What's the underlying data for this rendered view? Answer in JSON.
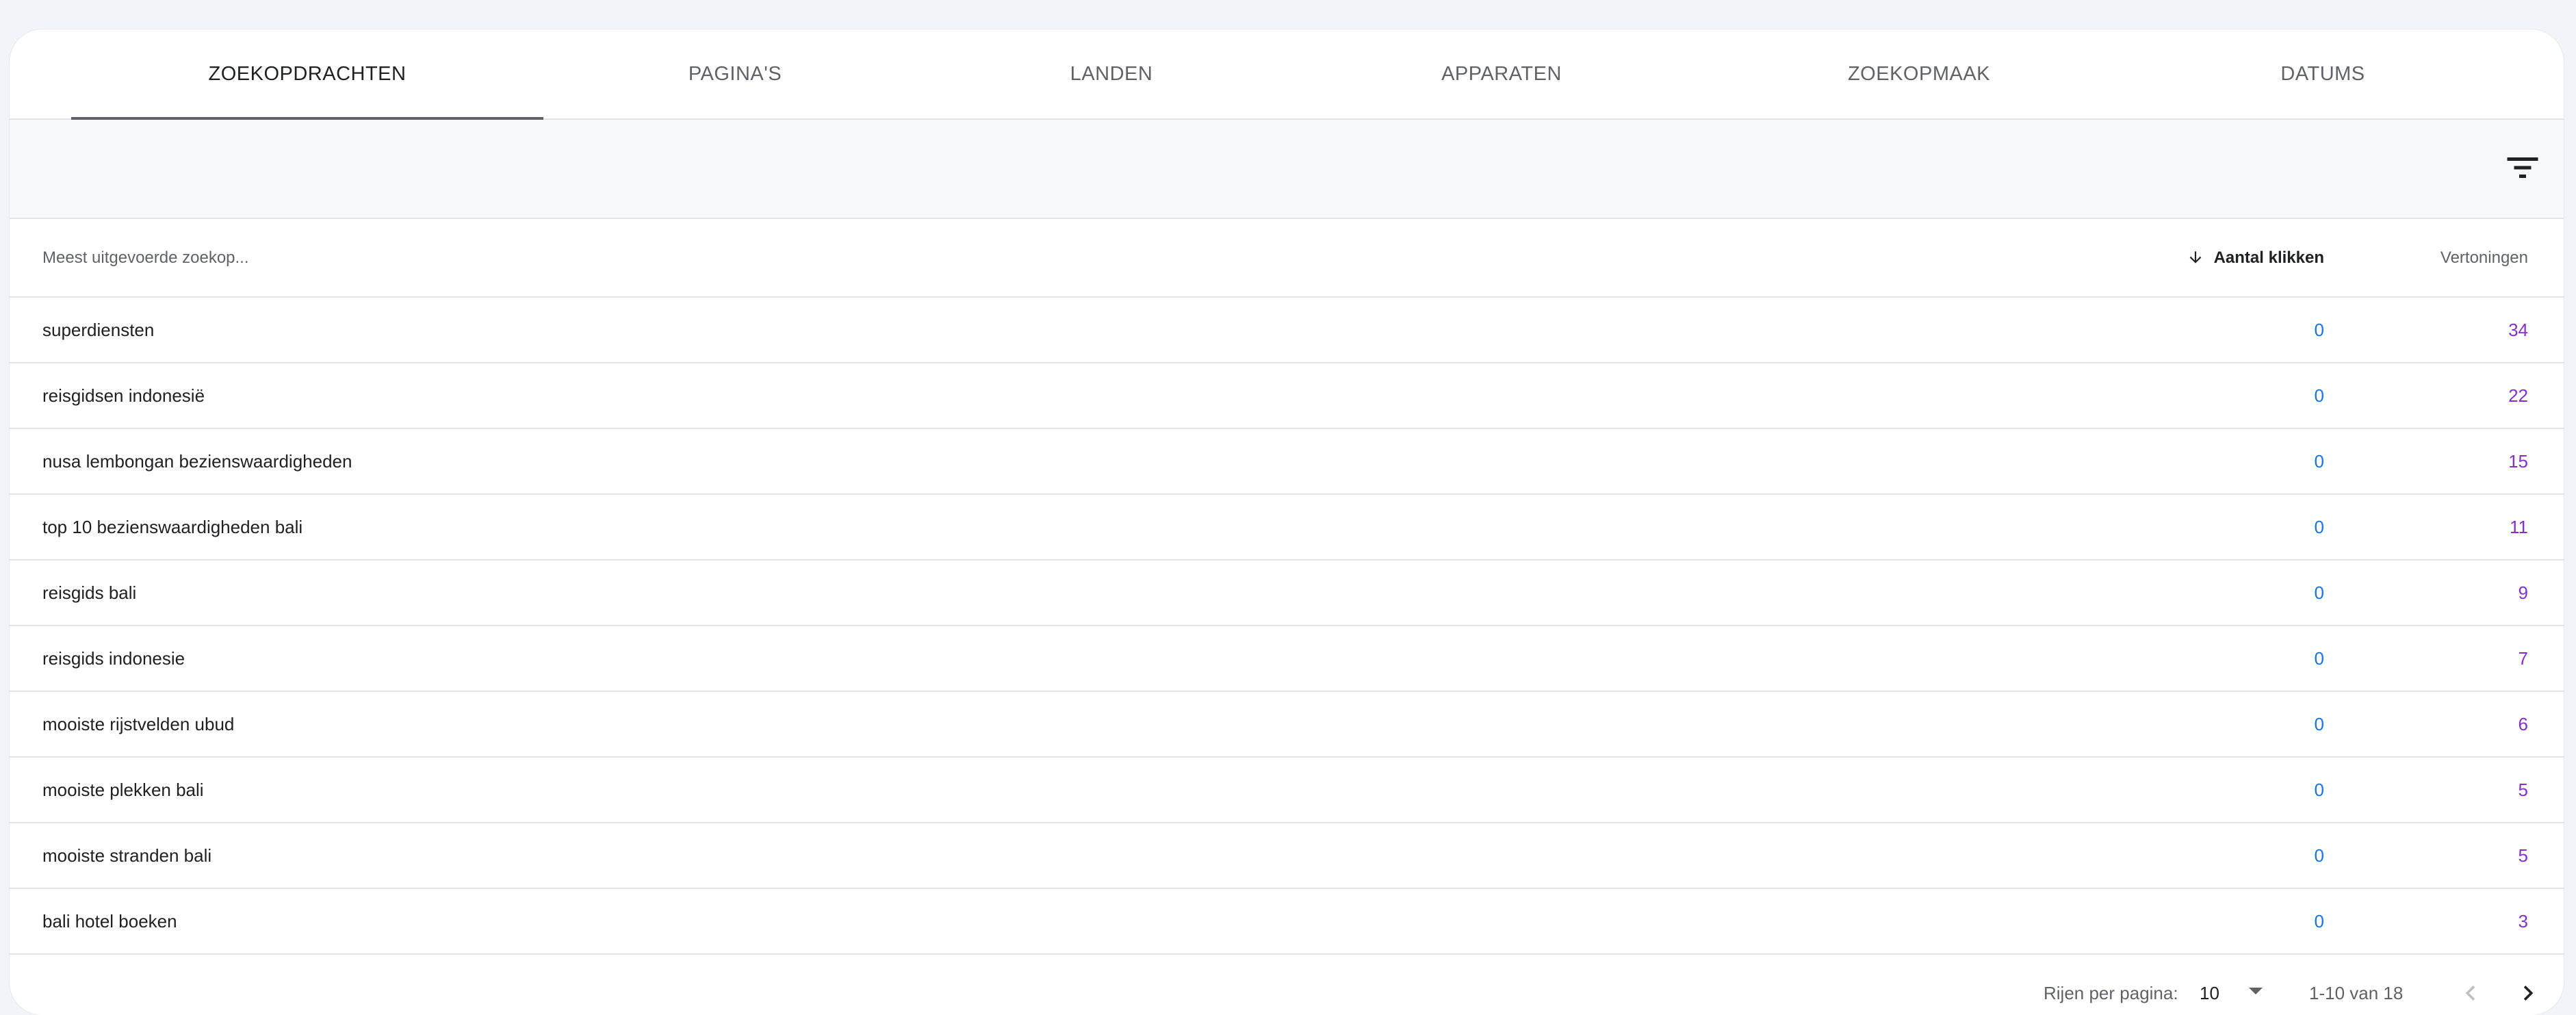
{
  "tabs": [
    {
      "label": "ZOEKOPDRACHTEN",
      "active": true
    },
    {
      "label": "PAGINA'S",
      "active": false
    },
    {
      "label": "LANDEN",
      "active": false
    },
    {
      "label": "APPARATEN",
      "active": false
    },
    {
      "label": "ZOEKOPMAAK",
      "active": false
    },
    {
      "label": "DATUMS",
      "active": false
    }
  ],
  "toolbar": {
    "filter_icon": "filter-list-icon"
  },
  "table": {
    "columns": {
      "query": "Meest uitgevoerde zoekop...",
      "clicks": "Aantal klikken",
      "impressions": "Vertoningen"
    },
    "sort_icon": "arrow-down-icon",
    "rows": [
      {
        "query": "superdiensten",
        "clicks": "0",
        "impressions": "34"
      },
      {
        "query": "reisgidsen indonesië",
        "clicks": "0",
        "impressions": "22"
      },
      {
        "query": "nusa lembongan bezienswaardigheden",
        "clicks": "0",
        "impressions": "15"
      },
      {
        "query": "top 10 bezienswaardigheden bali",
        "clicks": "0",
        "impressions": "11"
      },
      {
        "query": "reisgids bali",
        "clicks": "0",
        "impressions": "9"
      },
      {
        "query": "reisgids indonesie",
        "clicks": "0",
        "impressions": "7"
      },
      {
        "query": "mooiste rijstvelden ubud",
        "clicks": "0",
        "impressions": "6"
      },
      {
        "query": "mooiste plekken bali",
        "clicks": "0",
        "impressions": "5"
      },
      {
        "query": "mooiste stranden bali",
        "clicks": "0",
        "impressions": "5"
      },
      {
        "query": "bali hotel boeken",
        "clicks": "0",
        "impressions": "3"
      }
    ]
  },
  "pagination": {
    "rows_label": "Rijen per pagina:",
    "rows_value": "10",
    "range": "1-10 van 18"
  },
  "colors": {
    "clicks": "#1a73e8",
    "impressions": "#8430ce"
  }
}
